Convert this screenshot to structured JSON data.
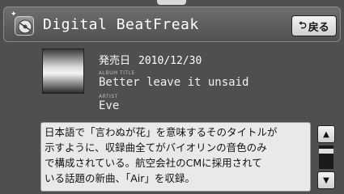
{
  "header": {
    "title": "Digital BeatFreak",
    "back_label": "戻る",
    "app_icon": "disc-icon"
  },
  "track": {
    "release_label": "発売日",
    "release_date": "2010/12/30",
    "album_caption": "ALBUM TITLE",
    "album_title": "Better leave it unsaid",
    "artist_caption": "ARTIST",
    "artist": "Eve"
  },
  "description": "日本語で「言わぬが花」を意味するそのタイトルが\n示すように、収録曲全てがバイオリンの音色のみ\nで構成されている。航空会社のCMに採用されて\nいる話題の新曲、「Air」を収録。",
  "scroll": {
    "up_icon": "up-arrow-icon",
    "down_icon": "down-arrow-icon"
  }
}
